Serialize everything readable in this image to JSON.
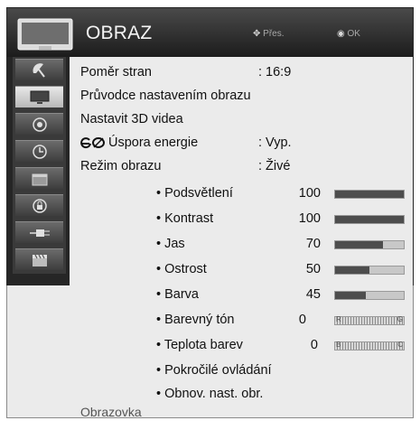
{
  "header": {
    "title": "OBRAZ",
    "move_hint": "Přes.",
    "ok_hint": "OK"
  },
  "sidebar": {
    "items": [
      {
        "icon": "satellite-dish-icon",
        "active": false
      },
      {
        "icon": "tv-picture-icon",
        "active": true
      },
      {
        "icon": "speaker-icon",
        "active": false
      },
      {
        "icon": "clock-icon",
        "active": false
      },
      {
        "icon": "calendar-icon",
        "active": false
      },
      {
        "icon": "lock-icon",
        "active": false
      },
      {
        "icon": "connector-icon",
        "active": false
      },
      {
        "icon": "film-clapper-icon",
        "active": false
      }
    ]
  },
  "menu": {
    "aspect_label": "Poměr stran",
    "aspect_value": ": 16:9",
    "wizard_label": "Průvodce nastavením obrazu",
    "video3d_label": "Nastavit 3D videa",
    "energy_label": "Úspora energie",
    "energy_value": ": Vyp.",
    "mode_label": "Režim obrazu",
    "mode_value": ": Živé"
  },
  "settings": [
    {
      "label": "• Podsvětlení",
      "value": "100",
      "level": 100,
      "type": "bar"
    },
    {
      "label": "• Kontrast",
      "value": "100",
      "level": 100,
      "type": "bar"
    },
    {
      "label": "• Jas",
      "value": "70",
      "level": 70,
      "type": "bar"
    },
    {
      "label": "• Ostrost",
      "value": "50",
      "level": 50,
      "type": "bar"
    },
    {
      "label": "• Barva",
      "value": "45",
      "level": 45,
      "type": "bar"
    },
    {
      "label": "• Barevný tón",
      "value": "0",
      "left_mark": "R",
      "right_mark": "G",
      "type": "balance"
    },
    {
      "label": "• Teplota barev",
      "value": "0",
      "left_mark": "B",
      "right_mark": "C",
      "type": "balance"
    },
    {
      "label": "• Pokročilé ovládání",
      "type": "link"
    },
    {
      "label": "• Obnov. nast. obr.",
      "type": "link"
    }
  ],
  "footer": {
    "label": "Obrazovka"
  }
}
